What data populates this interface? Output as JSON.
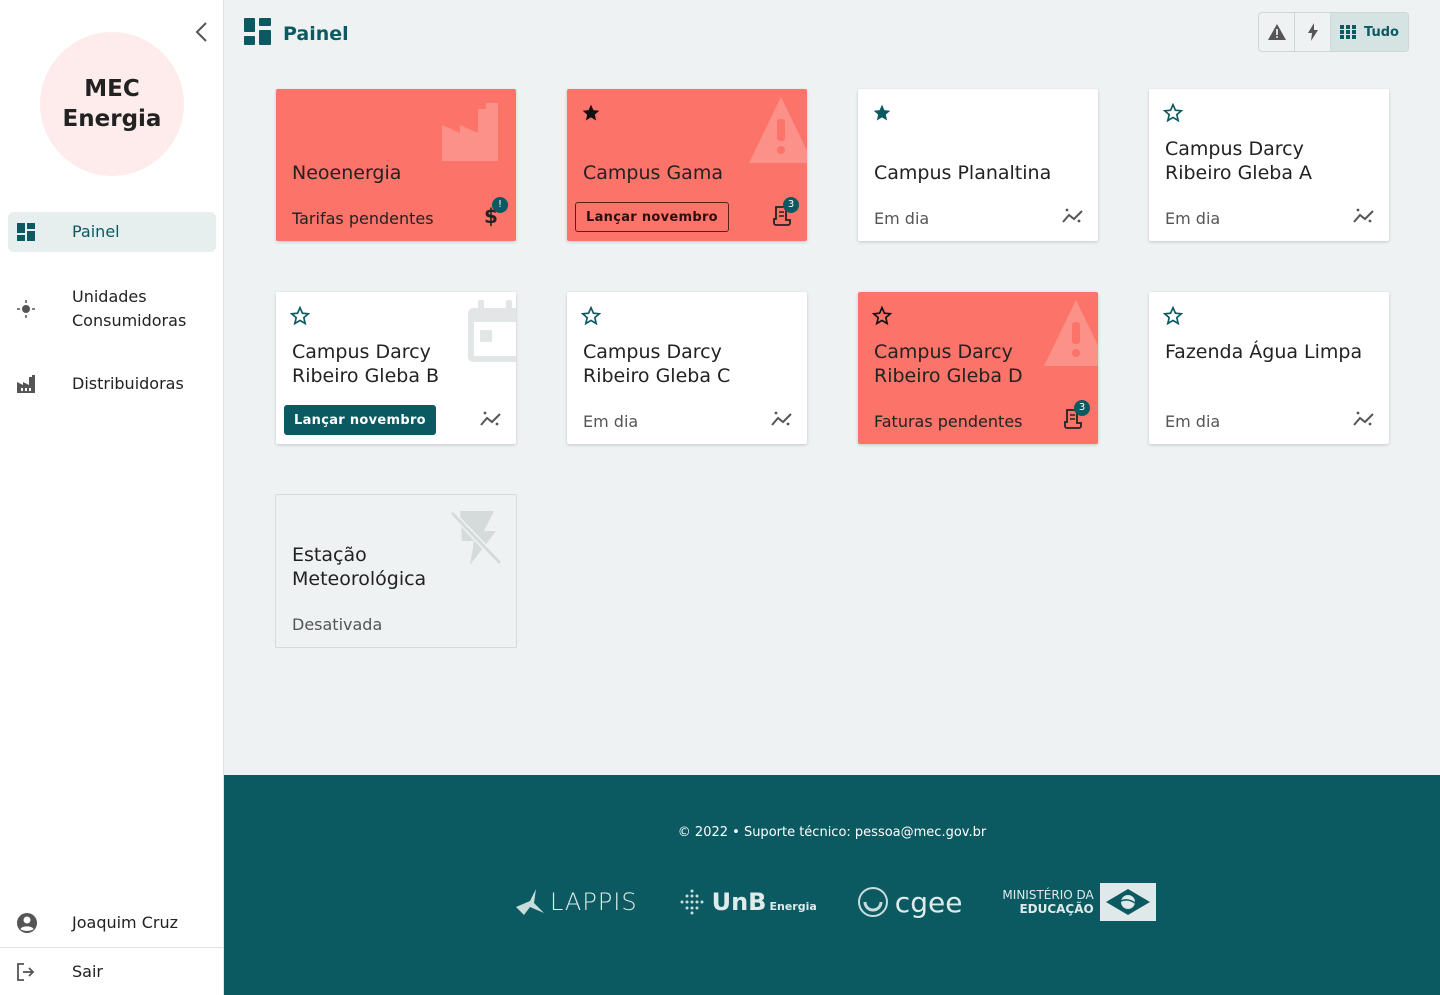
{
  "brand": {
    "line1": "MEC",
    "line2": "Energia"
  },
  "sidebar": {
    "items": [
      {
        "label": "Painel",
        "active": true,
        "icon": "dashboard-icon"
      },
      {
        "label": "Unidades Consumidoras",
        "icon": "lightbulb-icon"
      },
      {
        "label": "Distribuidoras",
        "icon": "factory-icon"
      }
    ],
    "user": {
      "name": "Joaquim Cruz",
      "icon": "account-circle-icon"
    },
    "logout": {
      "label": "Sair",
      "icon": "logout-icon"
    }
  },
  "header": {
    "title": "Painel",
    "icon": "dashboard-icon"
  },
  "filters": {
    "pending_icon": "warning-icon",
    "active_icon": "bolt-icon",
    "all_label": "Tudo",
    "selected": "Tudo"
  },
  "cards": [
    {
      "name": "Neoenergia",
      "status": "Tarifas pendentes",
      "favorite": null,
      "variant": "red",
      "badge": "!",
      "action_icon": "dollar-icon",
      "bg_icon": "factory-icon"
    },
    {
      "name": "Campus Gama",
      "button": "Lançar novembro",
      "favorite": true,
      "variant": "red",
      "badge": "3",
      "action_icon": "receipt-icon",
      "bg_icon": "warning-icon"
    },
    {
      "name": "Campus Planaltina",
      "status": "Em dia",
      "favorite": true,
      "variant": "white",
      "action_icon": "insights-icon"
    },
    {
      "name": "Campus Darcy Ribeiro Gleba A",
      "status": "Em dia",
      "favorite": false,
      "variant": "white",
      "action_icon": "insights-icon"
    },
    {
      "name": "Campus Darcy Ribeiro Gleba B",
      "button": "Lançar novembro",
      "favorite": false,
      "variant": "white",
      "action_icon": "insights-icon",
      "bg_icon": "calendar-icon"
    },
    {
      "name": "Campus Darcy Ribeiro Gleba C",
      "status": "Em dia",
      "favorite": false,
      "variant": "white",
      "action_icon": "insights-icon"
    },
    {
      "name": "Campus Darcy Ribeiro Gleba D",
      "status": "Faturas pendentes",
      "favorite": false,
      "variant": "red",
      "badge": "3",
      "action_icon": "receipt-icon",
      "bg_icon": "warning-icon"
    },
    {
      "name": "Fazenda Água Limpa",
      "status": "Em dia",
      "favorite": false,
      "variant": "white",
      "action_icon": "insights-icon"
    },
    {
      "name": "Estação Meteorológica",
      "status": "Desativada",
      "favorite": null,
      "variant": "disabled",
      "bg_icon": "flash-off-icon"
    }
  ],
  "footer": {
    "copyright": "© 2022  •  Suporte técnico: pessoa@mec.gov.br",
    "logos": {
      "lappis": "LAPPIS",
      "unb": "UnB",
      "unb_sub": "Energia",
      "cgee": "cgee",
      "mec_line1": "MINISTÉRIO DA",
      "mec_line2": "EDUCAÇÃO"
    }
  },
  "colors": {
    "primary": "#0b5a62",
    "alert": "#fb7369",
    "background": "#eef2f2"
  }
}
